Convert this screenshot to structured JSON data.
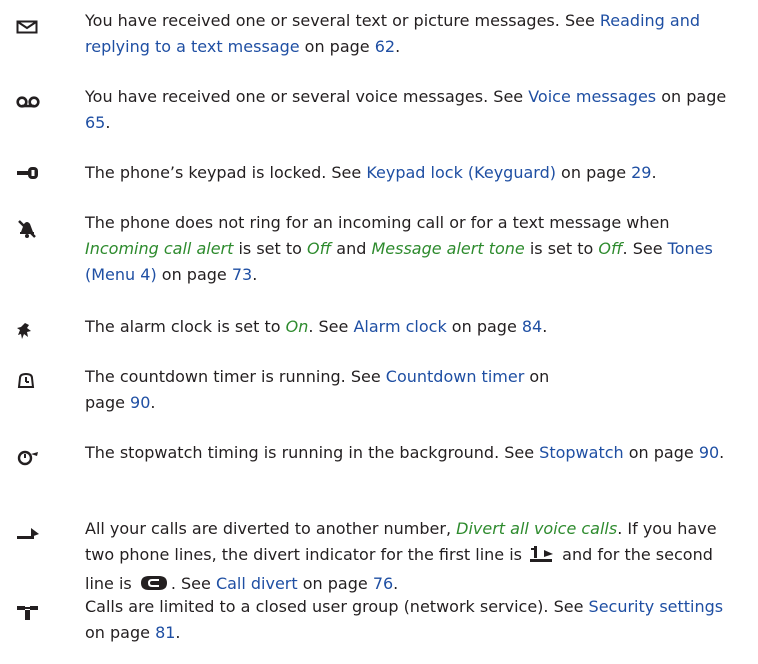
{
  "entries": [
    {
      "icon": "envelope-icon",
      "t1": "You have received one or several text or picture messages. See ",
      "link1": "Reading and replying to a text message",
      "t2": " on page ",
      "page": "62",
      "t3": "."
    },
    {
      "icon": "voicemail-icon",
      "t1": "You have received one or several voice messages. See ",
      "link1": "Voice messages",
      "t2": " on page ",
      "page": "65",
      "t3": "."
    },
    {
      "icon": "key-icon",
      "t1": "The phone’s keypad is locked. See ",
      "link1": "Keypad lock (Keyguard)",
      "t2": " on page ",
      "page": "29",
      "t3": "."
    },
    {
      "icon": "silent-bell-icon",
      "t1": "The phone does not ring for an incoming call or for a text message when ",
      "em1": "Incoming call alert",
      "t2": " is set to ",
      "em2": "Off",
      "t3": " and ",
      "em3": "Message alert tone",
      "t4": " is set to ",
      "em4": "Off",
      "t5": ". See ",
      "link1": "Tones (Menu 4)",
      "t6": " on page ",
      "page": "73",
      "t7": "."
    },
    {
      "icon": "alarm-clock-icon",
      "t1": "The alarm clock is set to ",
      "em1": "On",
      "t2": ". See ",
      "link1": "Alarm clock",
      "t3": " on page ",
      "page": "84",
      "t4": "."
    },
    {
      "icon": "countdown-timer-icon",
      "t1": "The countdown timer is running. See ",
      "link1": "Countdown timer",
      "t2": " on",
      "t3": "page ",
      "page": "90",
      "t4": "."
    },
    {
      "icon": "stopwatch-icon",
      "t1": "The stopwatch timing is running in the background. See ",
      "link1": "Stopwatch",
      "t2": " on page ",
      "page": "90",
      "t3": "."
    },
    {
      "icon": "call-divert-icon",
      "t1": "All your calls are diverted to another number, ",
      "em1": "Divert all voice calls",
      "t2": ". If you have two phone lines, the divert indicator for the first line is ",
      "t3": " and for the second line is ",
      "t4": ". See ",
      "link1": "Call divert",
      "t5": " on page ",
      "page": "76",
      "t6": "."
    },
    {
      "icon": "closed-user-group-icon",
      "t1": "Calls are limited to a closed user group (network service). See ",
      "link1": "Security settings",
      "t2": " on page ",
      "page": "81",
      "t3": "."
    }
  ],
  "colors": {
    "text": "#231f20",
    "link": "#1f4fa3",
    "emphasis": "#2e8b2e"
  }
}
